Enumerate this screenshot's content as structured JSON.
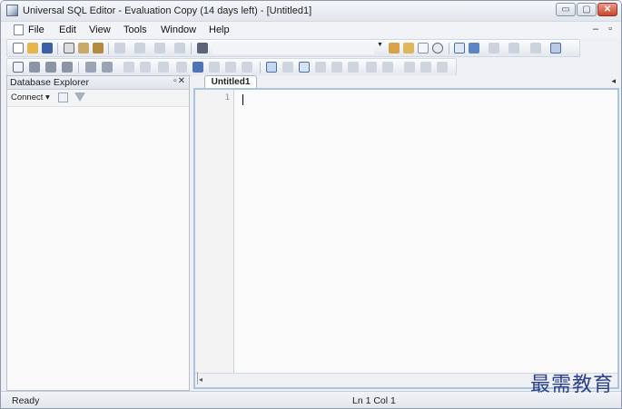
{
  "window": {
    "title": "Universal SQL Editor - Evaluation Copy (14 days left) - [Untitled1]",
    "buttons": {
      "minimize": "▭",
      "maximize": "▢",
      "close": "✕"
    }
  },
  "menubar": {
    "items": [
      {
        "label": "File"
      },
      {
        "label": "Edit"
      },
      {
        "label": "View"
      },
      {
        "label": "Tools"
      },
      {
        "label": "Window"
      },
      {
        "label": "Help"
      }
    ],
    "mdi_controls": "– ▫"
  },
  "toolbar1": {
    "icons": [
      "new-file-icon",
      "open-folder-icon",
      "save-icon",
      "cut-icon",
      "copy-icon",
      "paste-icon",
      "undo-icon",
      "redo-icon",
      "comment-icon",
      "uncomment-icon",
      "find-icon",
      "connection-icon",
      "query-icon",
      "table-icon",
      "refresh-icon",
      "execute-icon",
      "stop-icon",
      "explain-icon",
      "format-icon",
      "options-icon"
    ]
  },
  "toolbar2": {
    "icons": [
      "bookmark-icon",
      "indent-icon",
      "outdent-icon",
      "replace-icon",
      "case-icon",
      "align-icon",
      "highlight-icon",
      "wrap-icon",
      "grid-icon",
      "list-icon",
      "check-icon",
      "collapse-icon",
      "expand-icon",
      "sort-icon",
      "filter-icon"
    ]
  },
  "explorer": {
    "title": "Database Explorer",
    "pin": "▫✕",
    "connect_label": "Connect ▾"
  },
  "editor": {
    "tab_label": "Untitled1",
    "line_number": "1",
    "scroll_right": "◂"
  },
  "statusbar": {
    "status": "Ready",
    "position": "Ln 1  Col 1"
  },
  "watermark": "最需教育",
  "colors": {
    "editor_border": "#a8c4de",
    "accent_toolbar": "#5a86c6",
    "watermark": "#2b3f8c"
  }
}
